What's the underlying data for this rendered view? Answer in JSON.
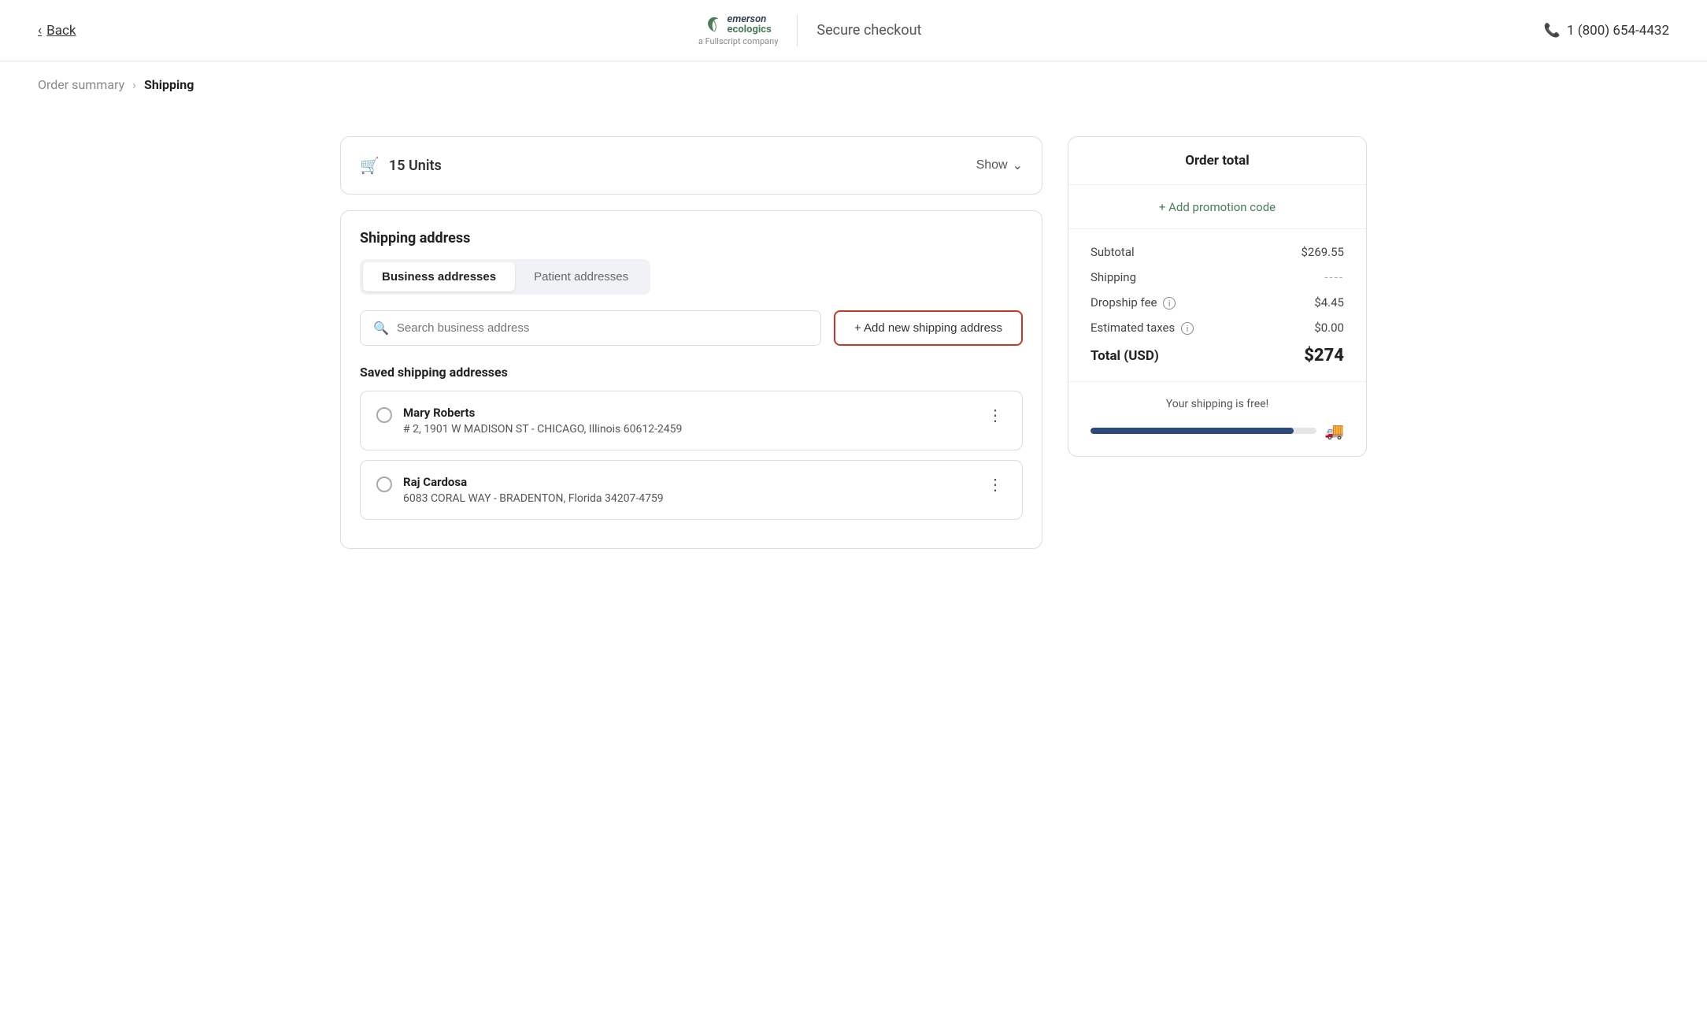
{
  "header": {
    "back_label": "Back",
    "logo_main": "emerson",
    "logo_sub_line1": "ecologics",
    "logo_sub_line2": "a Fullscript company",
    "secure_label": "Secure checkout",
    "phone": "1 (800) 654-4432"
  },
  "breadcrumb": {
    "step1": "Order summary",
    "arrow": "›",
    "step2": "Shipping"
  },
  "cart": {
    "units_label": "15 Units",
    "show_label": "Show"
  },
  "shipping": {
    "section_title": "Shipping address",
    "tab_business": "Business addresses",
    "tab_patient": "Patient addresses",
    "search_placeholder": "Search business address",
    "add_button": "+ Add new shipping address",
    "saved_title": "Saved shipping addresses",
    "addresses": [
      {
        "name": "Mary Roberts",
        "line": "# 2, 1901 W MADISON ST - CHICAGO, Illinois 60612-2459"
      },
      {
        "name": "Raj Cardosa",
        "line": "6083 CORAL WAY - BRADENTON, Florida 34207-4759"
      }
    ]
  },
  "order_total": {
    "title": "Order total",
    "promo_label": "+ Add promotion code",
    "subtotal_label": "Subtotal",
    "subtotal_value": "$269.55",
    "shipping_label": "Shipping",
    "shipping_value": "----",
    "dropship_label": "Dropship fee",
    "dropship_value": "$4.45",
    "taxes_label": "Estimated taxes",
    "taxes_value": "$0.00",
    "total_label": "Total (USD)",
    "total_value": "$274",
    "free_shipping_text": "Your shipping is free!",
    "progress_percent": 90
  }
}
